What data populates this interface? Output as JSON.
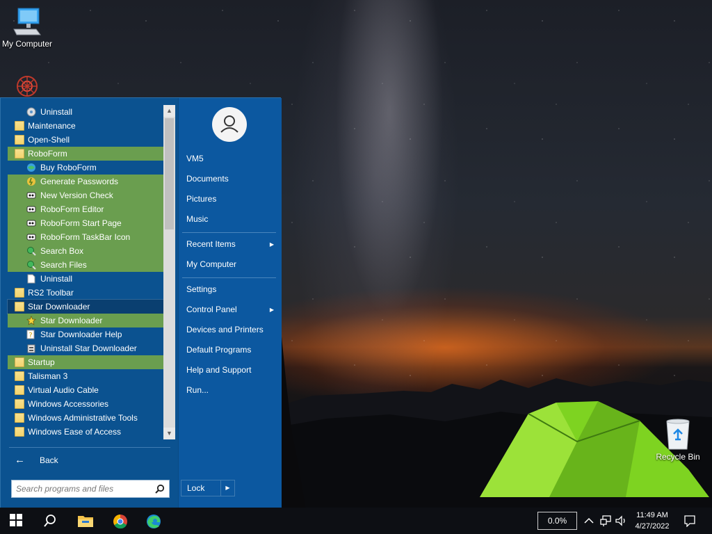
{
  "desktop": {
    "icons": [
      {
        "label": "My Computer"
      },
      {
        "label": ""
      },
      {
        "label": "Recycle Bin"
      }
    ]
  },
  "start_menu": {
    "programs": [
      {
        "label": "Uninstall",
        "indent": 1,
        "icon": "uninstall-disc-icon",
        "state": "normal"
      },
      {
        "label": "Maintenance",
        "indent": 0,
        "icon": "folder-icon",
        "state": "normal"
      },
      {
        "label": "Open-Shell",
        "indent": 0,
        "icon": "folder-icon",
        "state": "normal"
      },
      {
        "label": "RoboForm",
        "indent": 0,
        "icon": "folder-icon",
        "state": "highlight"
      },
      {
        "label": "Buy RoboForm",
        "indent": 1,
        "icon": "globe-icon",
        "state": "normal"
      },
      {
        "label": "Generate Passwords",
        "indent": 1,
        "icon": "password-generator-icon",
        "state": "highlight"
      },
      {
        "label": "New Version Check",
        "indent": 1,
        "icon": "roboform-icon",
        "state": "highlight"
      },
      {
        "label": "RoboForm Editor",
        "indent": 1,
        "icon": "roboform-icon",
        "state": "highlight"
      },
      {
        "label": "RoboForm Start Page",
        "indent": 1,
        "icon": "roboform-icon",
        "state": "highlight"
      },
      {
        "label": "RoboForm TaskBar Icon",
        "indent": 1,
        "icon": "roboform-icon",
        "state": "highlight"
      },
      {
        "label": "Search Box",
        "indent": 1,
        "icon": "search-globe-icon",
        "state": "highlight"
      },
      {
        "label": "Search Files",
        "indent": 1,
        "icon": "search-globe-icon",
        "state": "highlight"
      },
      {
        "label": "Uninstall",
        "indent": 1,
        "icon": "document-icon",
        "state": "normal"
      },
      {
        "label": "RS2 Toolbar",
        "indent": 0,
        "icon": "folder-icon",
        "state": "normal"
      },
      {
        "label": "Star Downloader",
        "indent": 0,
        "icon": "folder-icon",
        "state": "selected"
      },
      {
        "label": "Star Downloader",
        "indent": 1,
        "icon": "star-icon",
        "state": "highlight"
      },
      {
        "label": "Star Downloader Help",
        "indent": 1,
        "icon": "help-file-icon",
        "state": "normal"
      },
      {
        "label": "Uninstall Star Downloader",
        "indent": 1,
        "icon": "uninstall-icon",
        "state": "normal"
      },
      {
        "label": "Startup",
        "indent": 0,
        "icon": "folder-icon",
        "state": "highlight"
      },
      {
        "label": "Talisman 3",
        "indent": 0,
        "icon": "folder-icon",
        "state": "normal"
      },
      {
        "label": "Virtual Audio Cable",
        "indent": 0,
        "icon": "folder-icon",
        "state": "normal"
      },
      {
        "label": "Windows Accessories",
        "indent": 0,
        "icon": "folder-icon",
        "state": "normal"
      },
      {
        "label": "Windows Administrative Tools",
        "indent": 0,
        "icon": "folder-icon",
        "state": "normal"
      },
      {
        "label": "Windows Ease of Access",
        "indent": 0,
        "icon": "folder-icon",
        "state": "normal"
      }
    ],
    "back_label": "Back",
    "search_placeholder": "Search programs and files",
    "right_items": [
      {
        "label": "VM5",
        "arrow": false
      },
      {
        "label": "Documents",
        "arrow": false
      },
      {
        "label": "Pictures",
        "arrow": false
      },
      {
        "label": "Music",
        "arrow": false
      },
      {
        "label": "Recent Items",
        "arrow": true
      },
      {
        "label": "My Computer",
        "arrow": false
      },
      {
        "label": "Settings",
        "arrow": false
      },
      {
        "label": "Control Panel",
        "arrow": true
      },
      {
        "label": "Devices and Printers",
        "arrow": false
      },
      {
        "label": "Default Programs",
        "arrow": false
      },
      {
        "label": "Help and Support",
        "arrow": false
      },
      {
        "label": "Run...",
        "arrow": false
      }
    ],
    "lock_label": "Lock"
  },
  "taskbar": {
    "apps": [
      "windows-start-icon",
      "search-icon",
      "file-explorer-icon",
      "chrome-icon",
      "edge-icon"
    ],
    "cpu_usage": "0.0%",
    "time": "11:49 AM",
    "date": "4/27/2022"
  },
  "colors": {
    "menu_bg": "#0b5290",
    "highlight": "#6a9e4f",
    "folder": "#f4d56e"
  }
}
